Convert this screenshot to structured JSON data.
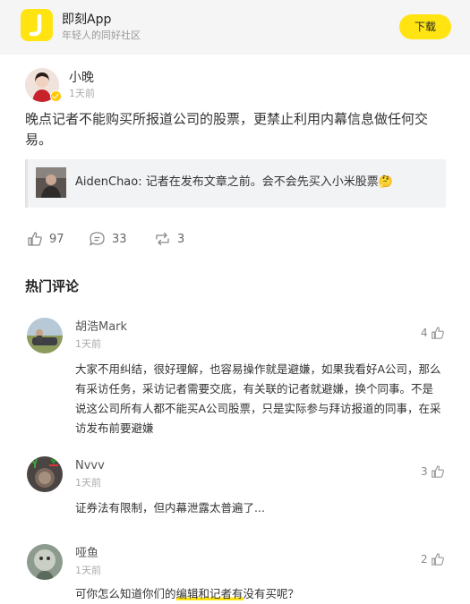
{
  "banner": {
    "app_name": "即刻App",
    "slogan": "年轻人的同好社区",
    "download_label": "下载"
  },
  "post": {
    "author": "小晚",
    "time": "1天前",
    "text": "晚点记者不能购买所报道公司的股票，更禁止利用内幕信息做任何交易。",
    "quote": {
      "text": "AidenChao: 记者在发布文章之前。会不会先买入小米股票🤔"
    },
    "actions": {
      "likes": "97",
      "comments": "33",
      "reposts": "3"
    }
  },
  "hot_comments": {
    "title": "热门评论",
    "items": [
      {
        "user": "胡浩Mark",
        "time": "1天前",
        "likes": "4",
        "text": "大家不用纠结，很好理解，也容易操作就是避嫌，如果我看好A公司，那么有采访任务，采访记者需要交底，有关联的记者就避嫌，换个同事。不是说这公司所有人都不能买A公司股票，只是实际参与拜访报道的同事，在采访发布前要避嫌"
      },
      {
        "user": "Nvvv",
        "time": "1天前",
        "likes": "3",
        "text": "证券法有限制，但内幕泄露太普遍了..."
      },
      {
        "user": "哑鱼",
        "time": "1天前",
        "likes": "2",
        "text_before": "可你怎么知道你们的",
        "text_highlight": "编辑和记者有",
        "text_after": "没有买呢？"
      }
    ]
  }
}
